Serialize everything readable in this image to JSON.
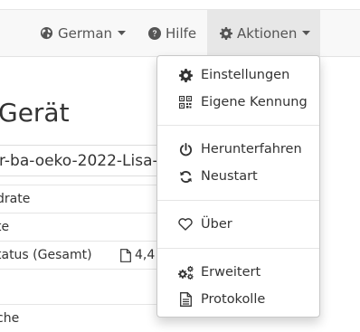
{
  "navbar": {
    "language_label": "German",
    "help_label": "Hilfe",
    "actions_label": "Aktionen"
  },
  "page": {
    "title": "Gerät",
    "device_name": "r-ba-oeko-2022-Lisa-"
  },
  "table": {
    "rows": [
      {
        "label": "drate"
      },
      {
        "label": "te"
      },
      {
        "label": "tatus (Gesamt)",
        "file_value": "4,4"
      },
      {
        "label": "che"
      }
    ]
  },
  "actions_menu": {
    "groups": [
      [
        {
          "label": "Einstellungen",
          "icon": "gear-icon"
        },
        {
          "label": "Eigene Kennung",
          "icon": "qrcode-icon"
        }
      ],
      [
        {
          "label": "Herunterfahren",
          "icon": "power-icon"
        },
        {
          "label": "Neustart",
          "icon": "refresh-icon"
        }
      ],
      [
        {
          "label": "Über",
          "icon": "heart-icon"
        }
      ],
      [
        {
          "label": "Erweitert",
          "icon": "gears-icon"
        },
        {
          "label": "Protokolle",
          "icon": "file-text-icon"
        }
      ]
    ]
  }
}
